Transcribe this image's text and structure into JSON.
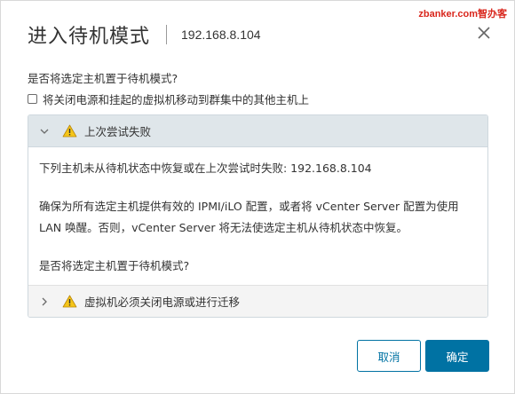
{
  "watermark": "zbanker.com智办客",
  "dialog": {
    "title": "进入待机模式",
    "subtitle": "192.168.8.104",
    "question": "是否将选定主机置于待机模式?",
    "checkbox_label": "将关闭电源和挂起的虚拟机移动到群集中的其他主机上",
    "checkbox_checked": false
  },
  "sections": [
    {
      "title": "上次尝试失败",
      "expanded": true,
      "icon": "warning-icon",
      "body": {
        "line1": "下列主机未从待机状态中恢复或在上次尝试时失败: 192.168.8.104",
        "line2a": "确保为所有选定主机提供有效的 IPMI/iLO 配置，或者将 vCenter Server 配置为使用",
        "line2b": "LAN 唤醒。否则，vCenter Server 将无法使选定主机从待机状态中恢复。",
        "line3": "是否将选定主机置于待机模式?"
      }
    },
    {
      "title": "虚拟机必须关闭电源或进行迁移",
      "expanded": false,
      "icon": "warning-icon"
    }
  ],
  "buttons": {
    "cancel": "取消",
    "ok": "确定"
  },
  "colors": {
    "primary": "#0072a3",
    "warning": "#f5c518",
    "section_header_bg": "#dfe6ea",
    "watermark": "#d9261c"
  }
}
